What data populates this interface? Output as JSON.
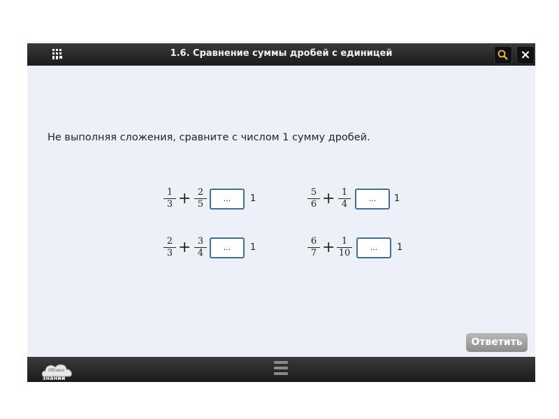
{
  "header": {
    "title": "1.6. Сравнение суммы дробей с единицей"
  },
  "task": {
    "instruction": "Не выполняя сложения, сравните с числом 1 сумму дробей."
  },
  "exercises": [
    {
      "a_num": "1",
      "a_den": "3",
      "b_num": "2",
      "b_den": "5",
      "placeholder": "...",
      "compare": "1"
    },
    {
      "a_num": "5",
      "a_den": "6",
      "b_num": "1",
      "b_den": "4",
      "placeholder": "...",
      "compare": "1"
    },
    {
      "a_num": "2",
      "a_den": "3",
      "b_num": "3",
      "b_den": "4",
      "placeholder": "...",
      "compare": "1"
    },
    {
      "a_num": "6",
      "a_den": "7",
      "b_num": "1",
      "b_den": "10",
      "placeholder": "...",
      "compare": "1"
    }
  ],
  "symbols": {
    "plus": "+"
  },
  "buttons": {
    "answer": "Ответить"
  },
  "footer": {
    "logo_line1": "Облако",
    "logo_line2": "знаний"
  },
  "icons": {
    "menu": "book-list-icon",
    "search": "magnifier-icon",
    "close": "close-icon",
    "handle": "menu-handle-icon"
  },
  "colors": {
    "topbar": "#222222",
    "background": "#eef0f8",
    "box_border": "#3f6f93",
    "answer_button": "#a3a3a3"
  }
}
